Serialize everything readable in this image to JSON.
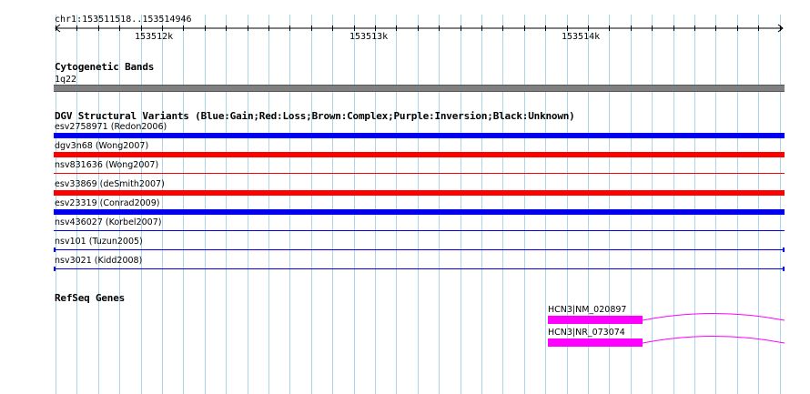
{
  "colors": {
    "gain": "#0000ee",
    "loss": "#ff0000",
    "gene": "#ff00ff",
    "band": "#808080",
    "grid": "#aad6ee",
    "ruler": "#000000"
  },
  "ruler": {
    "coordinates": "chr1:153511518..153514946",
    "ticks": [
      "153512k",
      "153513k",
      "153514k"
    ]
  },
  "cytoband": {
    "title": "Cytogenetic Bands",
    "band_label": "1q22"
  },
  "dgv": {
    "title": "DGV Structural Variants (Blue:Gain;Red:Loss;Brown:Complex;Purple:Inversion;Black:Unknown)",
    "variants": [
      {
        "label": "esv2758971 (Redon2006)",
        "color": "#0000ee"
      },
      {
        "label": "dgv3n68 (Wong2007)",
        "color": "#ff0000"
      },
      {
        "label": "nsv831636 (Wong2007)",
        "color": "#ff0000"
      },
      {
        "label": "esv33869 (deSmith2007)",
        "color": "#ff0000"
      },
      {
        "label": "esv23319 (Conrad2009)",
        "color": "#0000ee"
      },
      {
        "label": "nsv436027 (Korbel2007)",
        "color": "#0000ee"
      },
      {
        "label": "nsv101 (Tuzun2005)",
        "color": "#0000ee"
      },
      {
        "label": "nsv3021 (Kidd2008)",
        "color": "#0000ee"
      }
    ]
  },
  "refseq": {
    "title": "RefSeq Genes",
    "genes": [
      {
        "label": "HCN3|NM_020897"
      },
      {
        "label": "HCN3|NR_073074"
      }
    ]
  }
}
